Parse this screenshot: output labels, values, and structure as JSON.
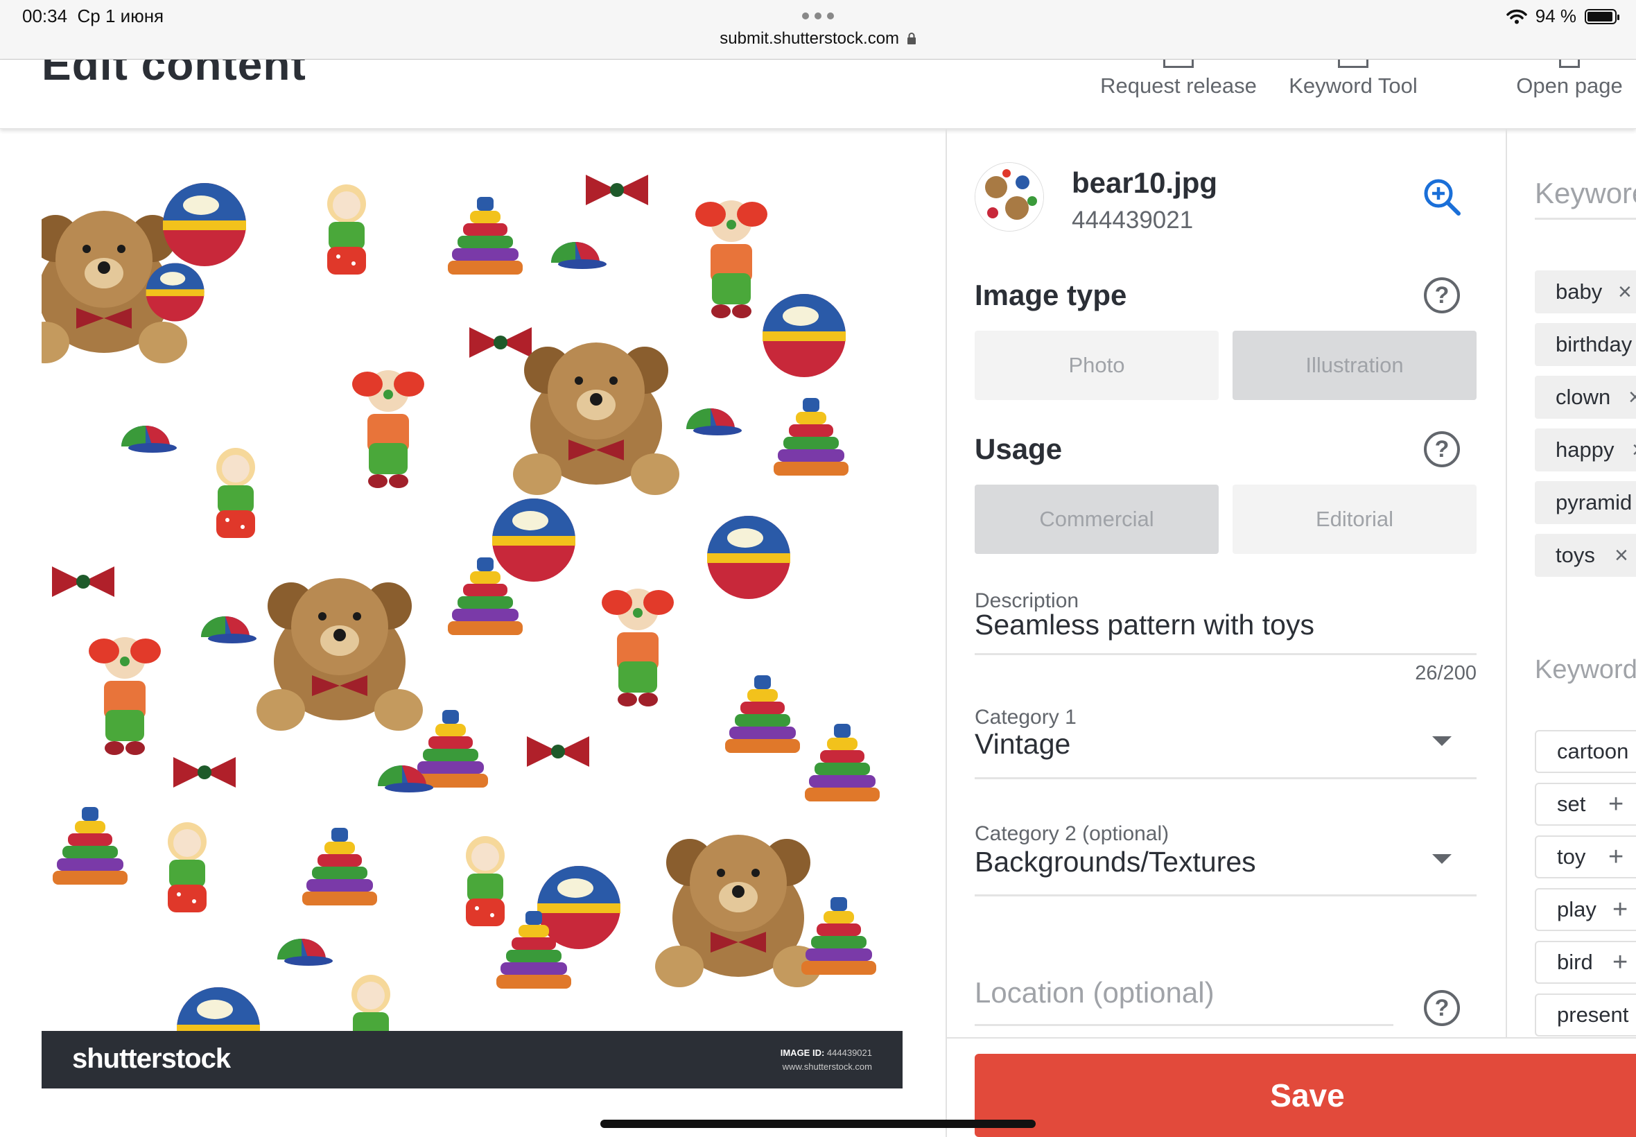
{
  "status_bar": {
    "time": "00:34",
    "date": "Ср 1 июня",
    "url": "submit.shutterstock.com",
    "battery": "94 %"
  },
  "header": {
    "title": "Edit content",
    "actions": [
      "Request release",
      "Keyword Tool",
      "Open page"
    ]
  },
  "preview": {
    "brand": "shutterstock",
    "image_id_label": "IMAGE ID:",
    "image_id": "444439021",
    "site": "www.shutterstock.com"
  },
  "details": {
    "filename": "bear10.jpg",
    "id": "444439021",
    "image_type": {
      "title": "Image type",
      "options": [
        "Photo",
        "Illustration"
      ],
      "selected": "Illustration"
    },
    "usage": {
      "title": "Usage",
      "options": [
        "Commercial",
        "Editorial"
      ],
      "selected": "Commercial"
    },
    "description": {
      "label": "Description",
      "value": "Seamless pattern with toys",
      "counter": "26/200"
    },
    "category1": {
      "label": "Category 1",
      "value": "Vintage"
    },
    "category2": {
      "label": "Category 2 (optional)",
      "value": "Backgrounds/Textures"
    },
    "location": {
      "placeholder": "Location (optional)"
    }
  },
  "keywords": {
    "input_label": "Keywore",
    "chips": [
      "baby",
      "birthday",
      "clown",
      "happy",
      "pyramid",
      "toys"
    ],
    "suggested_title": "Keyword",
    "suggested": [
      "cartoon",
      "set",
      "toy",
      "play",
      "bird",
      "present"
    ]
  },
  "save_label": "Save",
  "colors": {
    "save": "#e24a3b",
    "zoom_icon": "#1a6fd8",
    "dark_footer": "#2b2f36"
  }
}
